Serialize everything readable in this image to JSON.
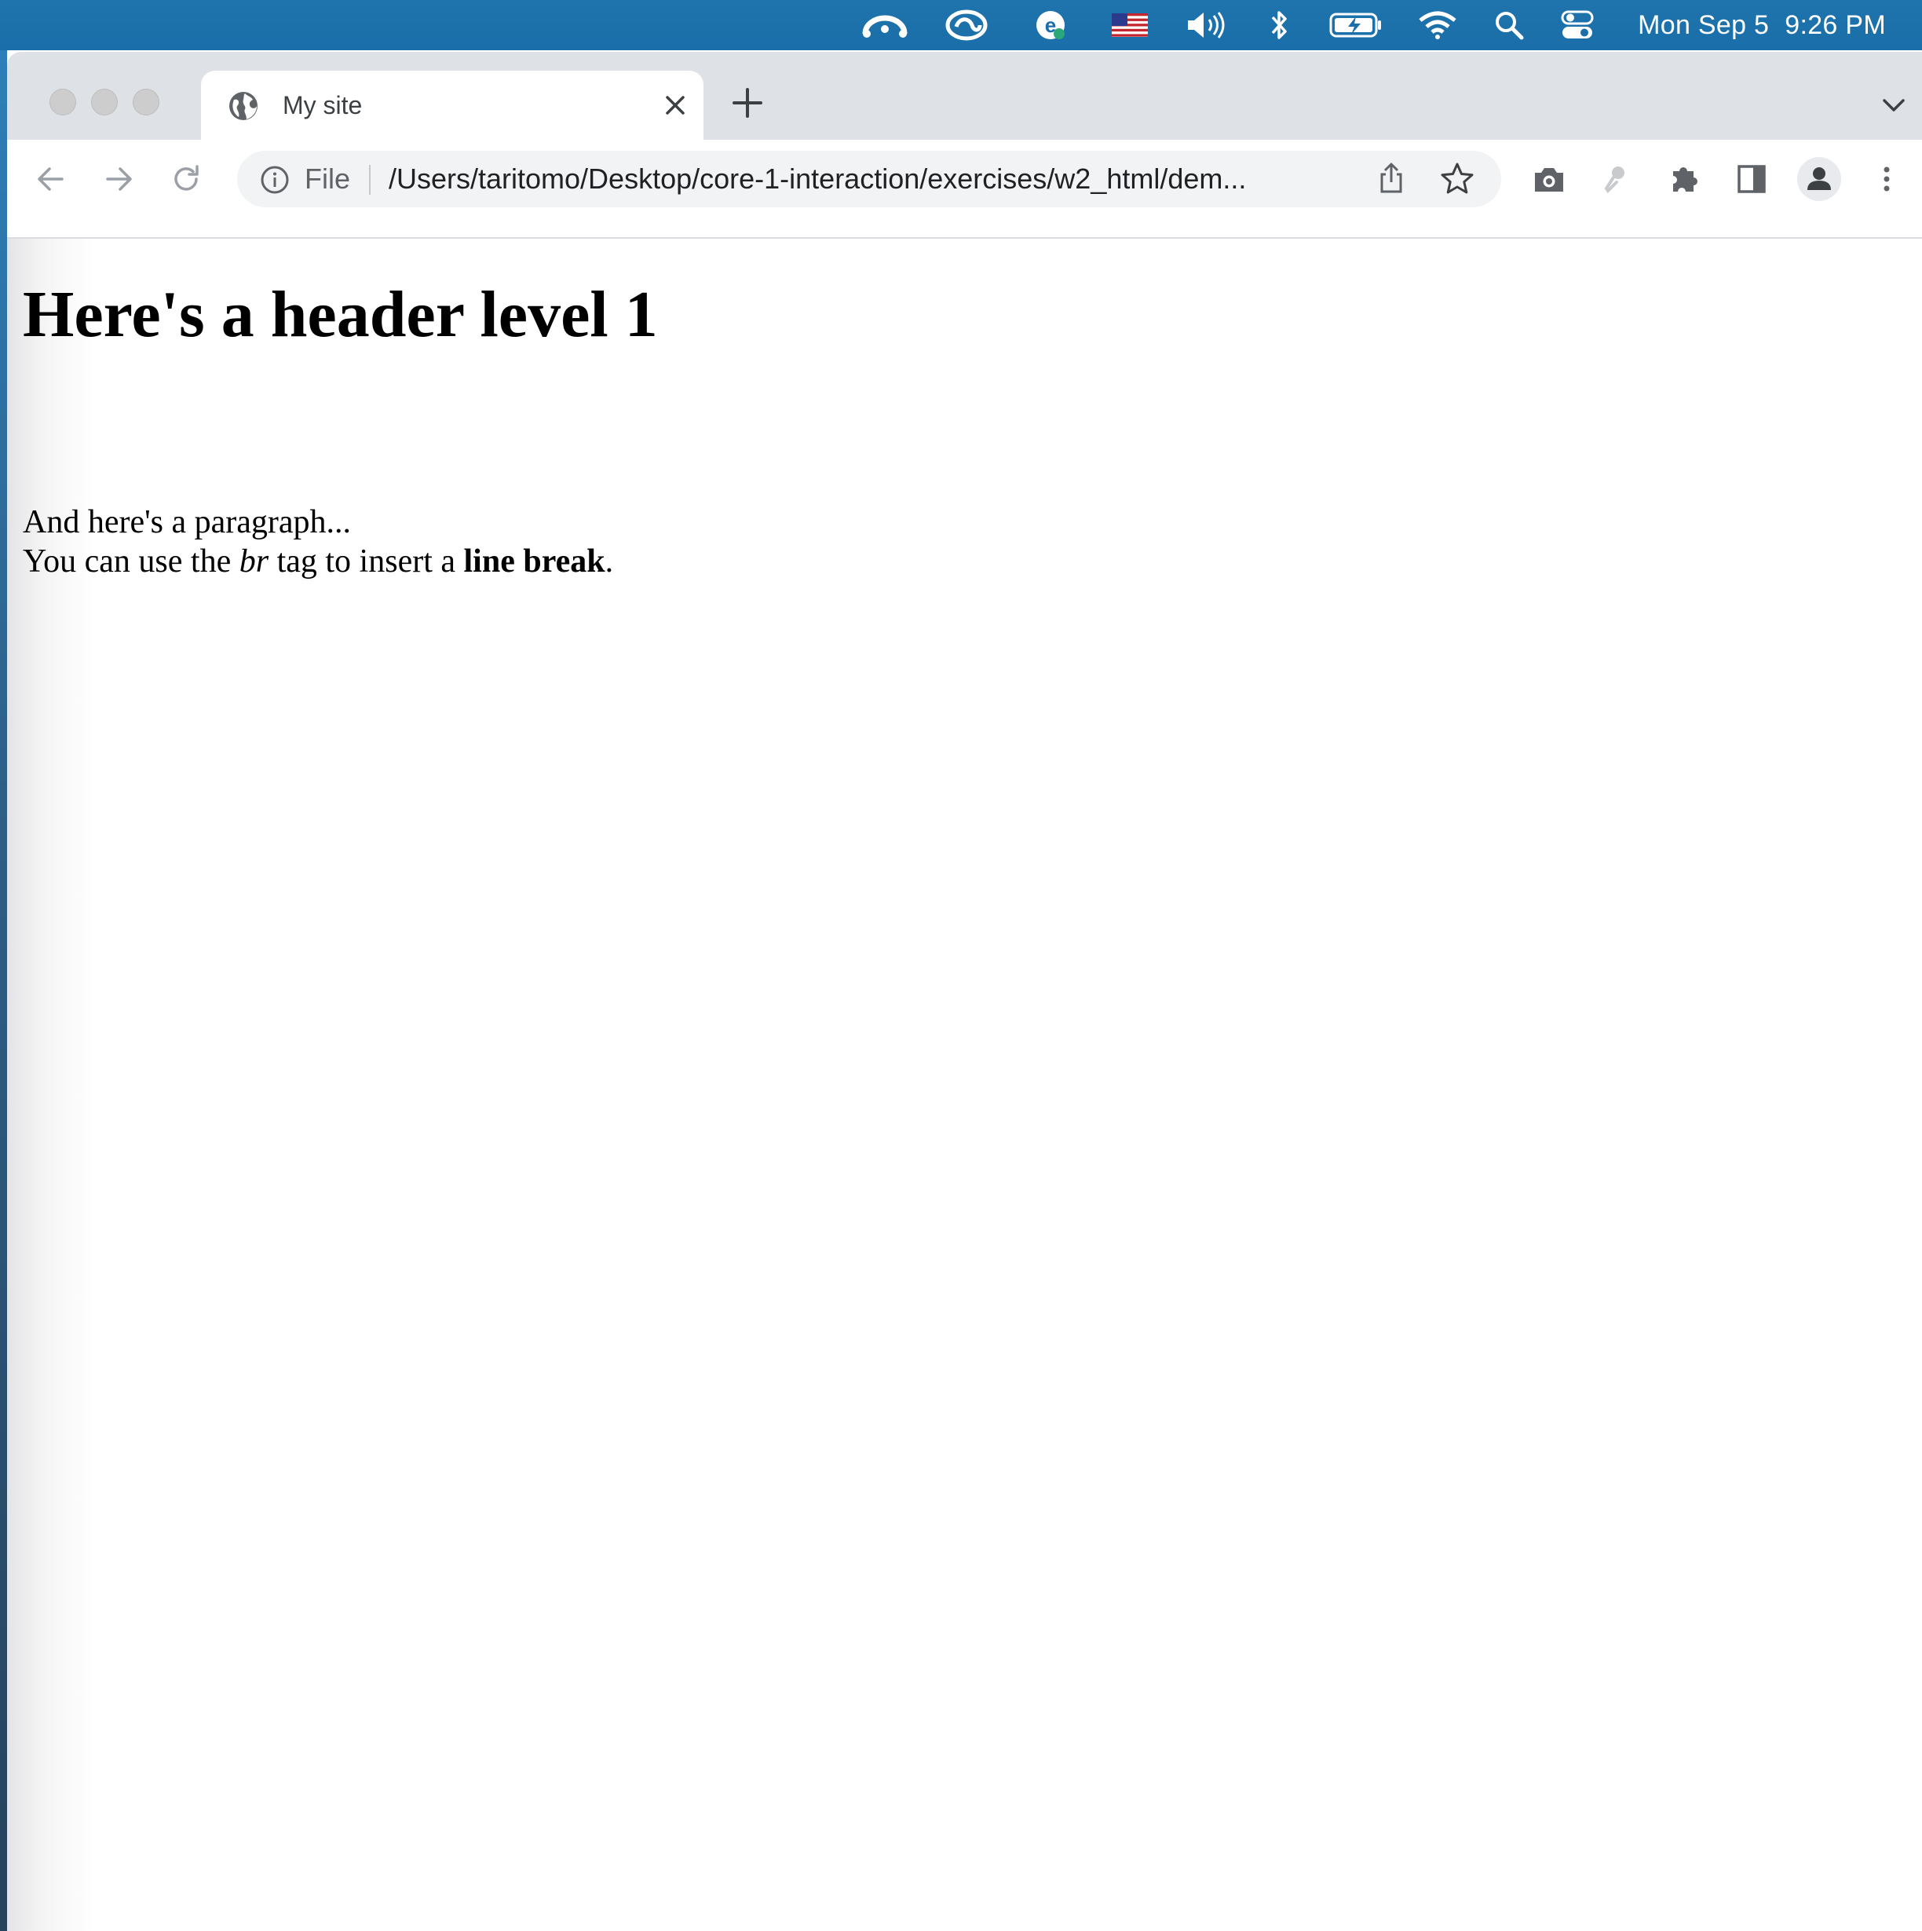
{
  "menubar": {
    "status_icons": [
      "cloud-sync-icon",
      "creative-cloud-icon",
      "grammarly-icon",
      "us-flag-input-icon",
      "volume-icon",
      "bluetooth-icon",
      "battery-charging-icon",
      "wifi-icon",
      "spotlight-search-icon",
      "control-center-icon"
    ],
    "date": "Mon Sep 5",
    "time": "9:26 PM"
  },
  "browser": {
    "tab": {
      "title": "My site",
      "favicon": "globe-icon"
    },
    "omnibox": {
      "scheme_label": "File",
      "url": "/Users/taritomo/Desktop/core-1-interaction/exercises/w2_html/dem..."
    },
    "toolbar_icons": [
      "back-arrow-icon",
      "forward-arrow-icon",
      "reload-icon",
      "camera-icon",
      "eyedropper-icon",
      "extensions-puzzle-icon",
      "side-panel-icon",
      "profile-avatar-icon",
      "more-menu-icon"
    ]
  },
  "page": {
    "heading": "Here's a header level 1",
    "paragraph_line1": "And here's a paragraph...",
    "paragraph_line2_start": "You can use the ",
    "paragraph_em": "br",
    "paragraph_line2_mid": " tag to insert a ",
    "paragraph_strong": "line break",
    "paragraph_line2_end": "."
  },
  "colors": {
    "menubar_blue": "#1a6ea9",
    "tabstrip_gray": "#dee1e6",
    "omnibox_gray": "#f1f3f4",
    "icon_gray": "#5f6368"
  }
}
